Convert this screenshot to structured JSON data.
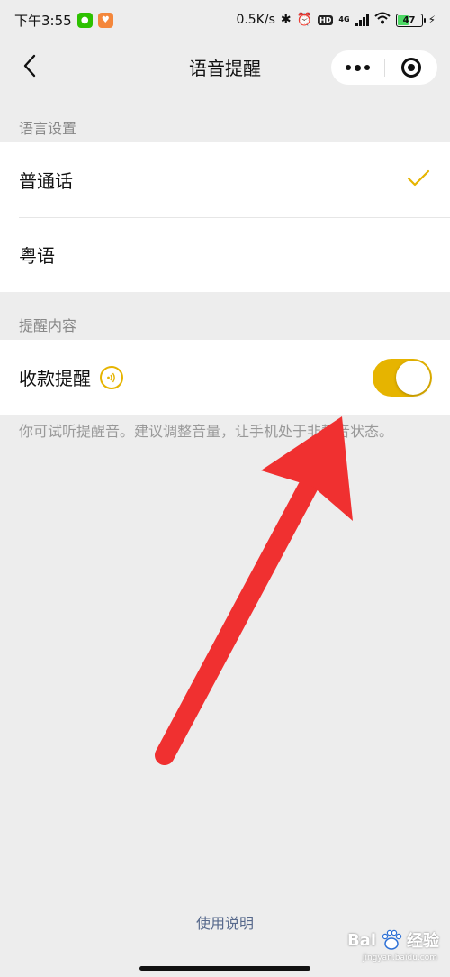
{
  "status_bar": {
    "time": "下午3:55",
    "network_speed": "0.5K/s",
    "network_type": "4G",
    "hd_badge": "HD",
    "battery_level": "47"
  },
  "nav": {
    "title": "语音提醒"
  },
  "sections": {
    "language": {
      "header": "语言设置",
      "options": [
        {
          "label": "普通话",
          "selected": true
        },
        {
          "label": "粤语",
          "selected": false
        }
      ]
    },
    "content": {
      "header": "提醒内容",
      "payment_alert_label": "收款提醒",
      "payment_alert_enabled": true
    }
  },
  "hint_text": "你可试听提醒音。建议调整音量，让手机处于非静音状态。",
  "footer": {
    "help_link": "使用说明"
  },
  "watermark": {
    "brand": "Bai",
    "brand_tail": "经验",
    "sub": "jingyan.baidu.com"
  },
  "colors": {
    "accent": "#e6b400",
    "link": "#57698c",
    "annotation_arrow": "#f03030"
  }
}
